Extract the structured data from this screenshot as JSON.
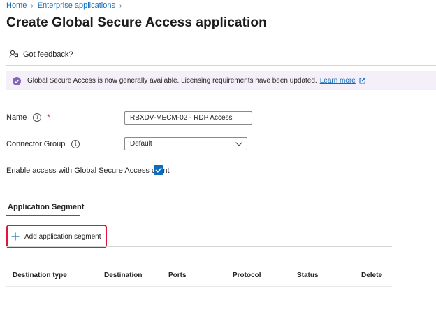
{
  "breadcrumb": {
    "items": [
      "Home",
      "Enterprise applications"
    ],
    "separator": ">"
  },
  "page": {
    "title": "Create Global Secure Access application",
    "more": "···"
  },
  "feedback": {
    "label": "Got feedback?"
  },
  "banner": {
    "message": "Global Secure Access is now generally available. Licensing requirements have been updated.",
    "link": "Learn more",
    "accent": "#8764b8"
  },
  "form": {
    "name": {
      "label": "Name",
      "required_mark": "*",
      "value": "RBXDV-MECM-02 - RDP Access"
    },
    "connector_group": {
      "label": "Connector Group",
      "value": "Default"
    },
    "gsa_client": {
      "label": "Enable access with Global Secure Access client",
      "checked": true
    }
  },
  "tabs": [
    {
      "label": "Application Segment",
      "active": true
    }
  ],
  "add_segment": {
    "label": "Add application segment",
    "highlight_color": "#e3143c"
  },
  "table": {
    "columns": [
      "Destination type",
      "Destination",
      "Ports",
      "Protocol",
      "Status",
      "Delete"
    ]
  },
  "colors": {
    "link": "#0f6cbd",
    "banner_bg": "#f4eff9",
    "checkbox": "#0f6cbd"
  }
}
